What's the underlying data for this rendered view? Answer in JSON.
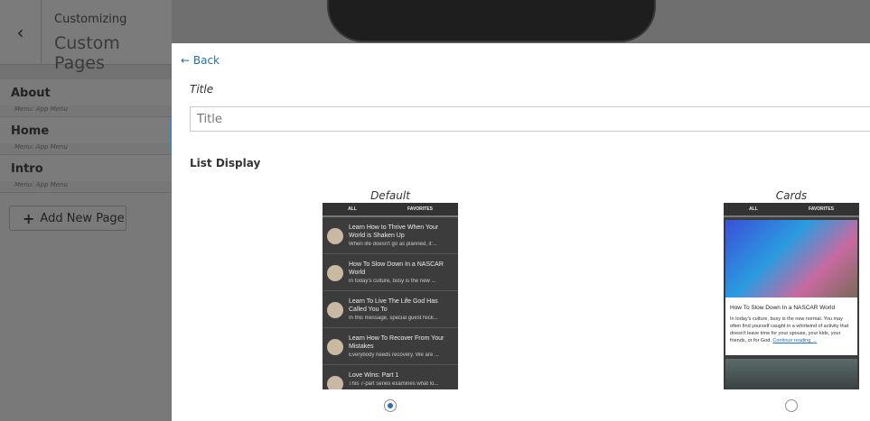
{
  "sidebar": {
    "back_icon": "chevron-left-icon",
    "subtitle": "Customizing",
    "title": "Custom Pages",
    "items": [
      {
        "label": "About",
        "menu": "Menu: App Menu"
      },
      {
        "label": "Home",
        "menu": "Menu: App Menu"
      },
      {
        "label": "Intro",
        "menu": "Menu: App Menu"
      }
    ],
    "add_button": "Add New Page"
  },
  "modal": {
    "back": "← Back",
    "title_label": "Title",
    "title_placeholder": "Title",
    "title_value": "",
    "list_display_label": "List Display",
    "options": [
      {
        "caption": "Default",
        "selected": true
      },
      {
        "caption": "Cards",
        "selected": false
      }
    ],
    "preview": {
      "tabs": [
        "ALL",
        "FAVORITES"
      ],
      "list": [
        {
          "title": "Learn How to Thrive When Your World is Shaken Up",
          "summary": "When life doesn't go as planned, it'..."
        },
        {
          "title": "How To Slow Down In a NASCAR World",
          "summary": "In today's culture, busy is the new ..."
        },
        {
          "title": "Learn To Live The Life God Has Called You To",
          "summary": "In this message, special guest Nick..."
        },
        {
          "title": "Learn How To Recover From Your Mistakes",
          "summary": "Everybody needs recovery. We are ..."
        },
        {
          "title": "Love Wins: Part 1",
          "summary": "This 7-part series examines what lo..."
        }
      ],
      "card": {
        "title": "How To Slow Down In a NASCAR World",
        "body": "In today's culture, busy is the new normal. You may often find yourself caught in a whirlwind of activity that doesn't leave time for your spouse, your kids, your friends, or for God.",
        "link": "Continue reading →"
      }
    }
  }
}
